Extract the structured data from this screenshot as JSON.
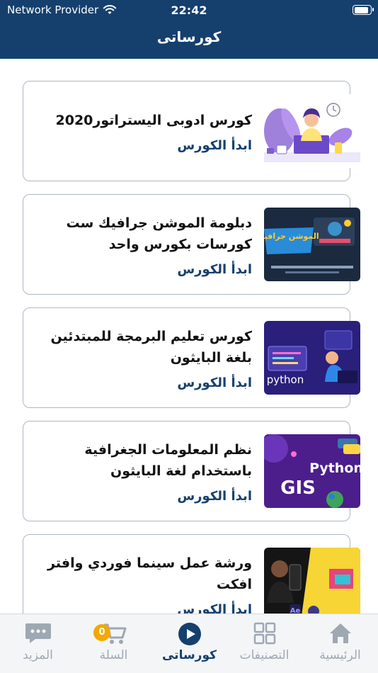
{
  "status_bar": {
    "carrier": "Network Provider",
    "time": "22:42",
    "battery_level": 0.9
  },
  "header": {
    "title": "كورساتى"
  },
  "courses": [
    {
      "title": "كورس ادوبى اليستراتور2020",
      "action": "ابدأ الكورس",
      "thumbnail": "illustrator-thumbnail"
    },
    {
      "title": "دبلومة الموشن جرافيك ست كورسات بكورس واحد",
      "action": "ابدأ الكورس",
      "thumbnail": "motion-graphics-thumbnail",
      "thumb_text": "الموشن جرافيك"
    },
    {
      "title": "كورس تعليم البرمجة للمبتدئين بلغة البايثون",
      "action": "ابدأ الكورس",
      "thumbnail": "python-beginners-thumbnail",
      "thumb_text": "python"
    },
    {
      "title": "نظم المعلومات الجغرافية باستخدام لغة البايثون",
      "action": "ابدأ الكورس",
      "thumbnail": "gis-python-thumbnail",
      "thumb_text": "GIS",
      "thumb_text2": "Python"
    },
    {
      "title": "ورشة عمل سينما فوردي وافتر افكت",
      "action": "ابدأ الكورس",
      "thumbnail": "cinema4d-aftereffects-thumbnail",
      "thumb_text": "Ae"
    }
  ],
  "tabs": [
    {
      "label": "الرئيسية",
      "icon": "home-icon"
    },
    {
      "label": "التصنيفات",
      "icon": "categories-grid-icon"
    },
    {
      "label": "كورساتى",
      "icon": "play-circle-icon",
      "active": true
    },
    {
      "label": "السلة",
      "icon": "cart-icon",
      "badge": "0"
    },
    {
      "label": "المزيد",
      "icon": "more-chat-icon"
    }
  ],
  "colors": {
    "primary": "#15406e",
    "badge": "#f2a900",
    "inactive_tab": "#9ea8b3"
  }
}
